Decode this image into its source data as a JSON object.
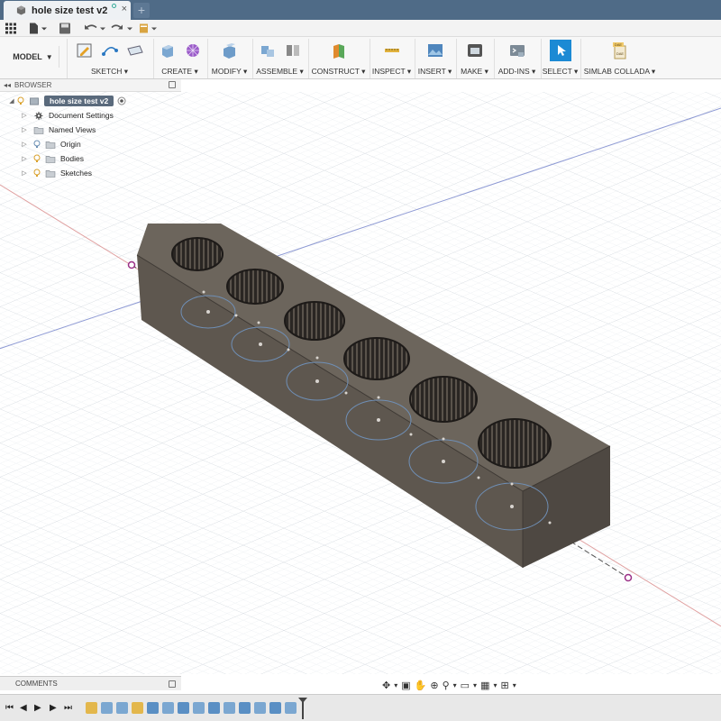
{
  "document_tab": {
    "title": "hole size test v2",
    "close_glyph": "×",
    "new_tab_glyph": "+"
  },
  "toolbar": {
    "workspace_label": "MODEL",
    "groups": [
      {
        "label": "SKETCH ▾"
      },
      {
        "label": "CREATE ▾"
      },
      {
        "label": "MODIFY ▾"
      },
      {
        "label": "ASSEMBLE ▾"
      },
      {
        "label": "CONSTRUCT ▾"
      },
      {
        "label": "INSPECT ▾"
      },
      {
        "label": "INSERT ▾"
      },
      {
        "label": "MAKE ▾"
      },
      {
        "label": "ADD-INS ▾"
      },
      {
        "label": "SELECT ▾"
      },
      {
        "label": "SIMLAB COLLADA ▾"
      }
    ],
    "dae_badge": "DAE"
  },
  "browser": {
    "title": "BROWSER",
    "collapse_glyph": "◂◂",
    "root": "hole size test v2",
    "items": [
      {
        "label": "Document Settings",
        "icon": "gear-icon"
      },
      {
        "label": "Named Views",
        "icon": "folder-icon"
      },
      {
        "label": "Origin",
        "icon": "folder-icon"
      },
      {
        "label": "Bodies",
        "icon": "folder-icon"
      },
      {
        "label": "Sketches",
        "icon": "folder-icon"
      }
    ]
  },
  "comments": {
    "label": "COMMENTS"
  },
  "colors": {
    "titlebar": "#4f6b87",
    "body_top": "#6c655c",
    "body_front": "#5e574f",
    "body_side": "#4e4842",
    "select_accent": "#1c8ad4"
  }
}
